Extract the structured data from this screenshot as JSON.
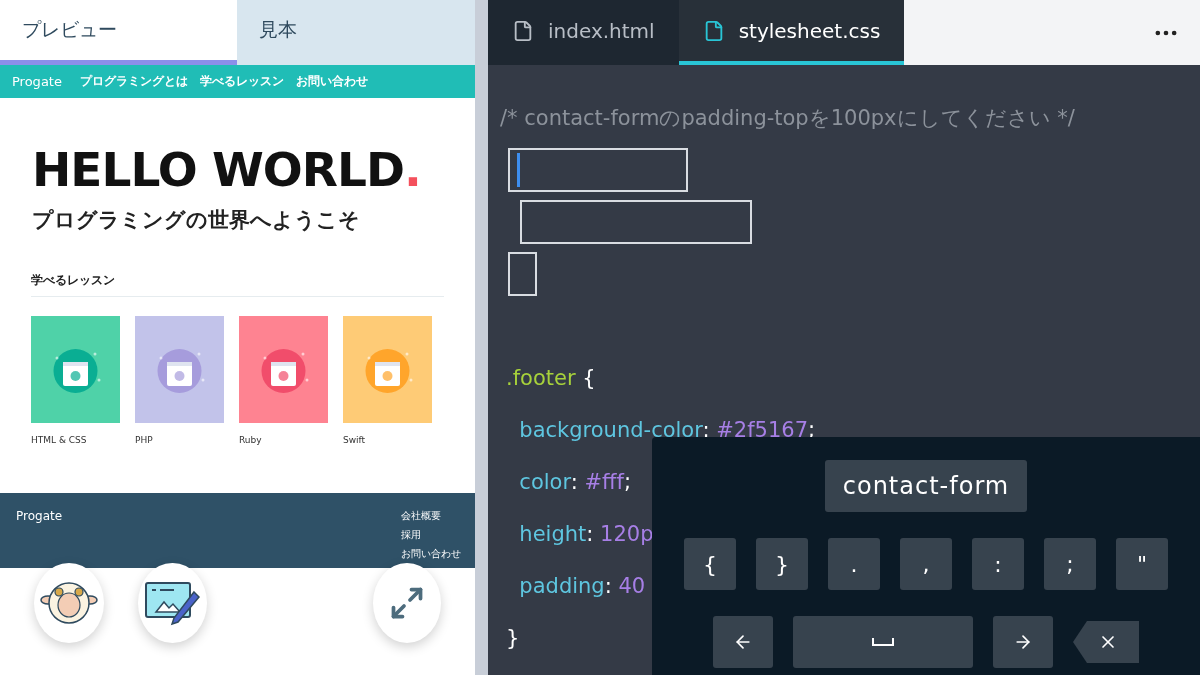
{
  "preview_tabs": [
    {
      "label": "プレビュー",
      "selected": true
    },
    {
      "label": "見本",
      "selected": false
    }
  ],
  "site": {
    "brand": "Progate",
    "nav": [
      "プログラミングとは",
      "学べるレッスン",
      "お問い合わせ"
    ],
    "hero_title": "HELLO WORLD",
    "hero_dot": ".",
    "hero_subtitle": "プログラミングの世界へようこそ",
    "lessons_title": "学べるレッスン",
    "lessons": [
      {
        "name": "HTML & CSS",
        "color": "#4fd2a8"
      },
      {
        "name": "PHP",
        "color": "#c2c3ea"
      },
      {
        "name": "Ruby",
        "color": "#fe8391"
      },
      {
        "name": "Swift",
        "color": "#fecb76"
      }
    ],
    "footer": {
      "brand": "Progate",
      "links": [
        "会社概要",
        "採用",
        "お問い合わせ"
      ]
    }
  },
  "file_tabs": [
    {
      "label": "index.html",
      "selected": false
    },
    {
      "label": "stylesheet.css",
      "selected": true
    }
  ],
  "code_lines": [
    {
      "kind": "comment",
      "parts": [
        {
          "kind": "comment",
          "text": "/* contact-formのpadding-topを100pxにしてください */"
        }
      ]
    },
    {
      "kind": "blank",
      "focused": true
    },
    {
      "kind": "blank",
      "focused": false
    },
    {
      "kind": "blank",
      "focused": false
    },
    {
      "kind": "empty"
    },
    {
      "kind": "code",
      "parts": [
        {
          "kind": "selector",
          "text": ".footer"
        },
        {
          "kind": "plain",
          "text": " {"
        }
      ]
    },
    {
      "kind": "code",
      "parts": [
        {
          "kind": "property",
          "text": "  background-color"
        },
        {
          "kind": "plain",
          "text": ": "
        },
        {
          "kind": "value",
          "text": "#2f5167"
        },
        {
          "kind": "plain",
          "text": ";"
        }
      ]
    },
    {
      "kind": "code",
      "parts": [
        {
          "kind": "property",
          "text": "  color"
        },
        {
          "kind": "plain",
          "text": ": "
        },
        {
          "kind": "value",
          "text": "#fff"
        },
        {
          "kind": "plain",
          "text": ";"
        }
      ]
    },
    {
      "kind": "code",
      "parts": [
        {
          "kind": "property",
          "text": "  height"
        },
        {
          "kind": "plain",
          "text": ": "
        },
        {
          "kind": "value",
          "text": "120p"
        }
      ]
    },
    {
      "kind": "code",
      "parts": [
        {
          "kind": "property",
          "text": "  padding"
        },
        {
          "kind": "plain",
          "text": ": "
        },
        {
          "kind": "value",
          "text": "40"
        }
      ]
    },
    {
      "kind": "code",
      "parts": [
        {
          "kind": "plain",
          "text": "}"
        }
      ]
    }
  ],
  "keyboard": {
    "suggestion": "contact-form",
    "symbols": [
      "{",
      "}",
      ".",
      ",",
      ":",
      ";",
      "\""
    ],
    "controls": [
      {
        "kind": "left"
      },
      {
        "kind": "space"
      },
      {
        "kind": "right"
      },
      {
        "kind": "backspace"
      }
    ]
  }
}
